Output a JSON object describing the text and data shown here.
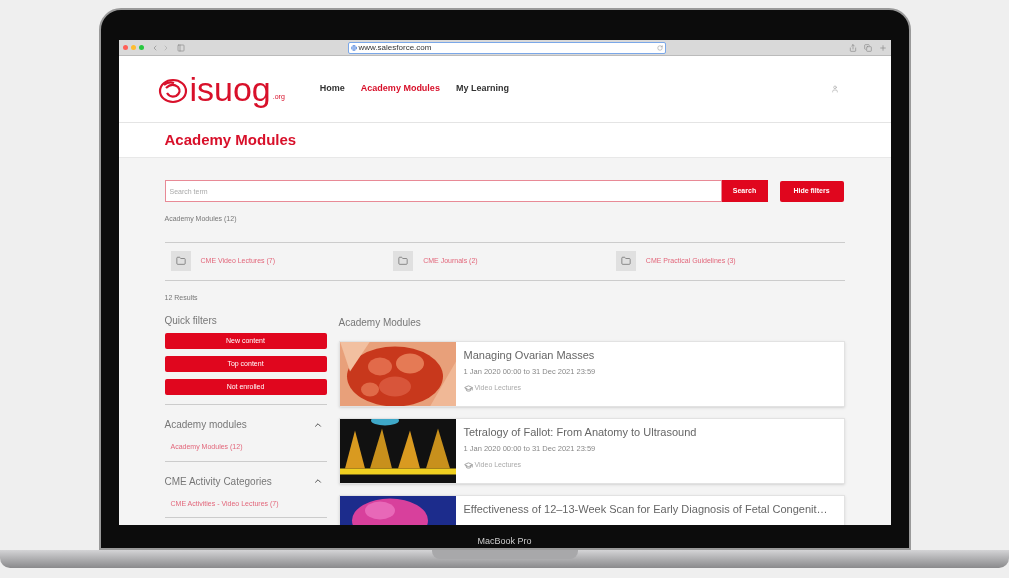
{
  "browser": {
    "url": "www.salesforce.com"
  },
  "logo": {
    "text": "isuog",
    "suffix": ".org"
  },
  "nav": [
    {
      "label": "Home",
      "selected": false
    },
    {
      "label": "Academy Modules",
      "selected": true
    },
    {
      "label": "My Learning",
      "selected": false
    }
  ],
  "page_title": "Academy Modules",
  "search": {
    "placeholder": "Search term",
    "button": "Search"
  },
  "hide_filters_button": "Hide filters",
  "breadcrumb": "Academy Modules (12)",
  "categories": [
    {
      "label": "CME Video Lectures (7)"
    },
    {
      "label": "CME Journals (2)"
    },
    {
      "label": "CME Practical Guidelines (3)"
    }
  ],
  "results_count": "12 Results",
  "quick_filters": {
    "title": "Quick filters",
    "buttons": [
      "New content",
      "Top content",
      "Not enrolled"
    ]
  },
  "filter_groups": [
    {
      "title": "Academy modules",
      "expanded": true,
      "items": [
        "Academy Modules (12)"
      ]
    },
    {
      "title": "CME Activity Categories",
      "expanded": true,
      "items": [
        "CME Activities - Video Lectures (7)"
      ]
    }
  ],
  "list": {
    "title": "Academy Modules",
    "modules": [
      {
        "title": "Managing Ovarian Masses",
        "dates": "1 Jan 2020 00:00 to 31 Dec 2021 23:59",
        "category": "Video Lectures"
      },
      {
        "title": "Tetralogy of Fallot: From Anatomy to Ultrasound",
        "dates": "1 Jan 2020 00:00 to 31 Dec 2021 23:59",
        "category": "Video Lectures"
      },
      {
        "title": "Effectiveness of 12–13-Week Scan for Early Diagnosis of Fetal Congenit…"
      }
    ]
  },
  "device_label": "MacBook Pro"
}
